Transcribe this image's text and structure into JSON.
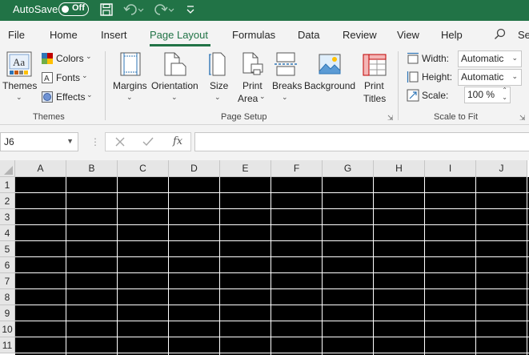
{
  "titlebar": {
    "autosave_label": "AutoSave",
    "autosave_state": "Off",
    "icons": [
      "save-icon",
      "undo-icon",
      "redo-icon",
      "customize-quick-access-icon"
    ],
    "accent_color": "#217346"
  },
  "tabs": [
    {
      "label": "File"
    },
    {
      "label": "Home"
    },
    {
      "label": "Insert"
    },
    {
      "label": "Page Layout",
      "active": true
    },
    {
      "label": "Formulas"
    },
    {
      "label": "Data"
    },
    {
      "label": "Review"
    },
    {
      "label": "View"
    },
    {
      "label": "Help"
    },
    {
      "label": "Se"
    }
  ],
  "ribbon": {
    "themes_group": {
      "themes_label": "Themes",
      "colors_label": "Colors",
      "fonts_label": "Fonts",
      "effects_label": "Effects",
      "group_label": "Themes"
    },
    "page_setup_group": {
      "margins_label": "Margins",
      "orientation_label": "Orientation",
      "size_label": "Size",
      "print_area_label_1": "Print",
      "print_area_label_2": "Area",
      "breaks_label": "Breaks",
      "background_label": "Background",
      "print_titles_label_1": "Print",
      "print_titles_label_2": "Titles",
      "group_label": "Page Setup"
    },
    "scale_group": {
      "width_label": "Width:",
      "width_value": "Automatic",
      "height_label": "Height:",
      "height_value": "Automatic",
      "scale_label": "Scale:",
      "scale_value": "100 %",
      "group_label": "Scale to Fit"
    }
  },
  "formula_bar": {
    "name_box": "J6",
    "fx_label": "fx",
    "formula": ""
  },
  "grid": {
    "columns": [
      "A",
      "B",
      "C",
      "D",
      "E",
      "F",
      "G",
      "H",
      "I",
      "J"
    ],
    "rows": [
      "1",
      "2",
      "3",
      "4",
      "5",
      "6",
      "7",
      "8",
      "9",
      "10",
      "11"
    ],
    "cell_fill": "#000000",
    "gridline_color": "#ffffff"
  }
}
